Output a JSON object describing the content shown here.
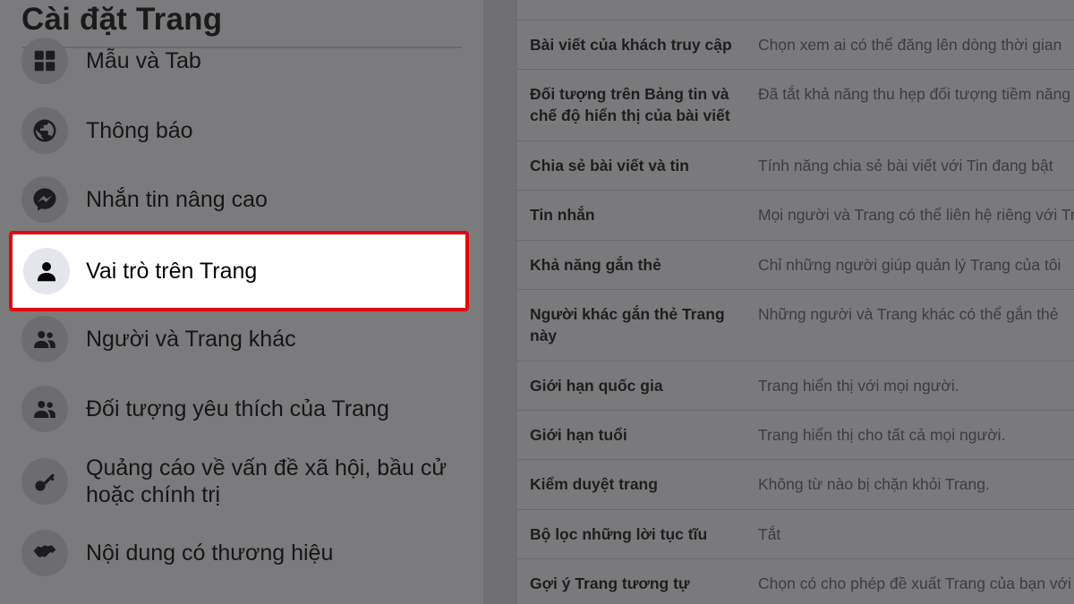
{
  "sidebar": {
    "title": "Cài đặt Trang",
    "items": [
      {
        "label": "Mẫu và Tab",
        "icon": "grid-icon"
      },
      {
        "label": "Thông báo",
        "icon": "globe-icon"
      },
      {
        "label": "Nhắn tin nâng cao",
        "icon": "messenger-icon"
      },
      {
        "label": "Vai trò trên Trang",
        "icon": "person-icon",
        "active": true
      },
      {
        "label": "Người và Trang khác",
        "icon": "people-icon"
      },
      {
        "label": "Đối tượng yêu thích của Trang",
        "icon": "people-icon"
      },
      {
        "label": "Quảng cáo về vấn đề xã hội, bầu cử hoặc chính trị",
        "icon": "key-icon"
      },
      {
        "label": "Nội dung có thương hiệu",
        "icon": "handshake-icon"
      }
    ],
    "highlight_color": "#e3060d"
  },
  "settings": {
    "rows": [
      {
        "label": "Bài viết của khách truy cập",
        "value": "Chọn xem ai có thể đăng lên dòng thời gian"
      },
      {
        "label": "Đối tượng trên Bảng tin và chế độ hiển thị của bài viết",
        "value": "Đã tắt khả năng thu hẹp đối tượng tiềm năng"
      },
      {
        "label": "Chia sẻ bài viết và tin",
        "value": "Tính năng chia sẻ bài viết với Tin đang bật"
      },
      {
        "label": "Tin nhắn",
        "value": "Mọi người và Trang có thể liên hệ riêng với Trang"
      },
      {
        "label": "Khả năng gắn thẻ",
        "value": "Chỉ những người giúp quản lý Trang của tôi"
      },
      {
        "label": "Người khác gắn thẻ Trang này",
        "value": "Những người và Trang khác có thể gắn thẻ"
      },
      {
        "label": "Giới hạn quốc gia",
        "value": "Trang hiển thị với mọi người."
      },
      {
        "label": "Giới hạn tuổi",
        "value": "Trang hiển thị cho tất cả mọi người."
      },
      {
        "label": "Kiểm duyệt trang",
        "value": "Không từ nào bị chặn khỏi Trang."
      },
      {
        "label": "Bộ lọc những lời tục tĩu",
        "value": "Tắt"
      },
      {
        "label": "Gợi ý Trang tương tự",
        "value": "Chọn có cho phép đề xuất Trang của bạn với"
      }
    ]
  }
}
